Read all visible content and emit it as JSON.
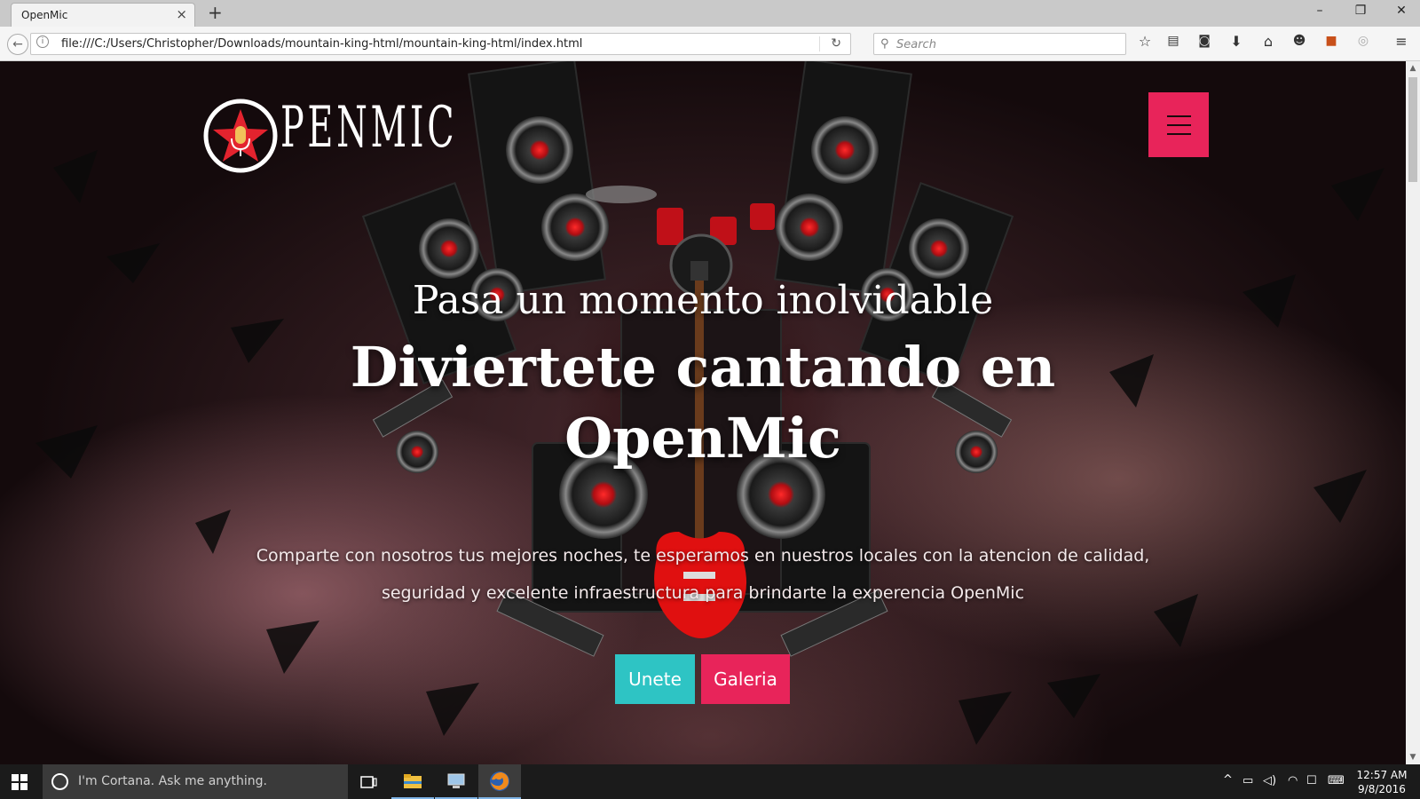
{
  "browser": {
    "tab_title": "OpenMic",
    "tab_close": "×",
    "new_tab": "+",
    "url": "file:///C:/Users/Christopher/Downloads/mountain-king-html/mountain-king-html/index.html",
    "search_placeholder": "Search",
    "window_controls": {
      "minimize": "–",
      "restore": "❐",
      "close": "✕"
    }
  },
  "page": {
    "logo_text": "PENMIC",
    "hero_subtitle": "Pasa un momento inolvidable",
    "hero_title": "Diviertete cantando en OpenMic",
    "hero_description": "Comparte con nosotros tus mejores noches, te esperamos en nuestros locales con la atencion de calidad, seguridad y excelente infraestructura para brindarte la experencia OpenMic",
    "buttons": {
      "join": "Unete",
      "gallery": "Galeria"
    },
    "colors": {
      "accent_pink": "#e8245a",
      "accent_teal": "#2ec4c4"
    }
  },
  "taskbar": {
    "cortana_placeholder": "I'm Cortana. Ask me anything.",
    "time": "12:57 AM",
    "date": "9/8/2016"
  }
}
